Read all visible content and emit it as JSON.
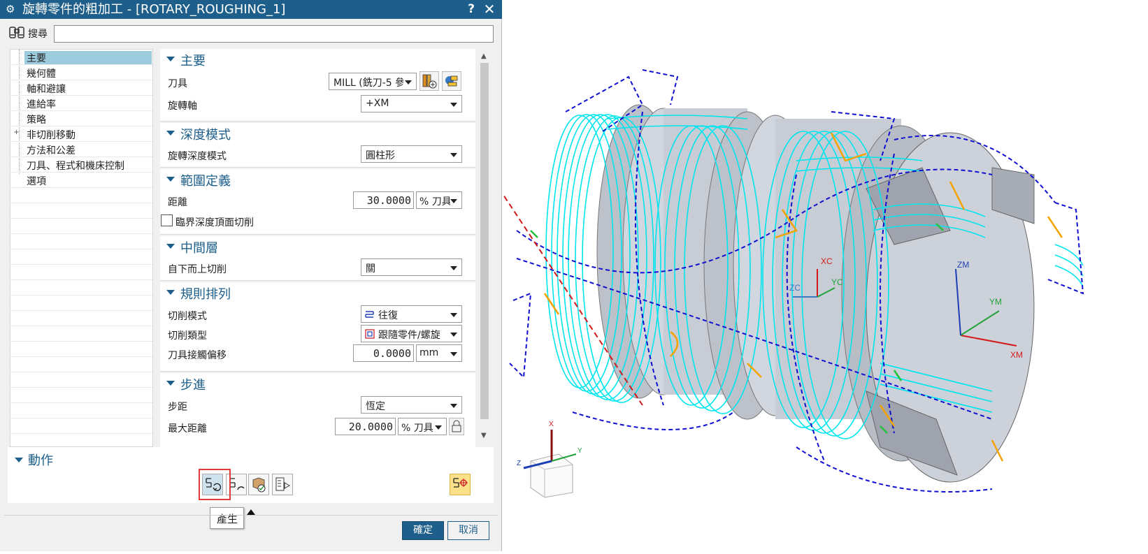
{
  "dialog": {
    "title": "旋轉零件的粗加工 - [ROTARY_ROUGHING_1]",
    "help_label": "?",
    "close_label": "✕",
    "settings_glyph": "⚙"
  },
  "search": {
    "label": "搜尋",
    "value": ""
  },
  "nav": {
    "items": [
      {
        "label": "主要",
        "selected": true
      },
      {
        "label": "幾何體"
      },
      {
        "label": "軸和避讓"
      },
      {
        "label": "進給率"
      },
      {
        "label": "策略"
      },
      {
        "label": "非切削移動",
        "expandable": true
      },
      {
        "label": "方法和公差"
      },
      {
        "label": "刀具、程式和機床控制"
      },
      {
        "label": "選項"
      }
    ]
  },
  "main": {
    "title": "主要",
    "tool_label": "刀具",
    "tool_value": "MILL (銑刀-5 參",
    "axis_label": "旋轉軸",
    "axis_value": "+XM"
  },
  "depth_mode": {
    "title": "深度模式",
    "label": "旋轉深度模式",
    "value": "圓柱形"
  },
  "range": {
    "title": "範圍定義",
    "distance_label": "距離",
    "distance_value": "30.0000",
    "distance_unit": "% 刀具",
    "critical_label": "臨界深度頂面切削"
  },
  "middle": {
    "title": "中間層",
    "label": "自下而上切削",
    "value": "關"
  },
  "pattern": {
    "title": "規則排列",
    "cut_mode_label": "切削模式",
    "cut_mode_value": "往復",
    "cut_type_label": "切削類型",
    "cut_type_value": "跟隨零件/螺旋",
    "offset_label": "刀具接觸偏移",
    "offset_value": "0.0000",
    "offset_unit": "mm"
  },
  "stepover": {
    "title": "步進",
    "step_label": "步距",
    "step_value": "恆定",
    "max_label": "最大距離",
    "max_value": "20.0000",
    "max_unit": "% 刀具"
  },
  "actions": {
    "title": "動作",
    "tooltip": "產生"
  },
  "footer": {
    "ok_label": "確定",
    "cancel_label": "取消"
  },
  "viewport": {
    "axes": {
      "xc": "XC",
      "yc": "YC",
      "zc": "ZC",
      "xm": "XM",
      "ym": "YM",
      "zm": "ZM",
      "x": "X",
      "y": "Y",
      "z": "Z"
    }
  },
  "colors": {
    "accent": "#1d5f8a",
    "toolpath": "#00e5ee",
    "path_blue": "#1010d0",
    "path_orange": "#f5a300",
    "part_gray": "#c8ccd4",
    "highlight": "#e13a3a"
  }
}
